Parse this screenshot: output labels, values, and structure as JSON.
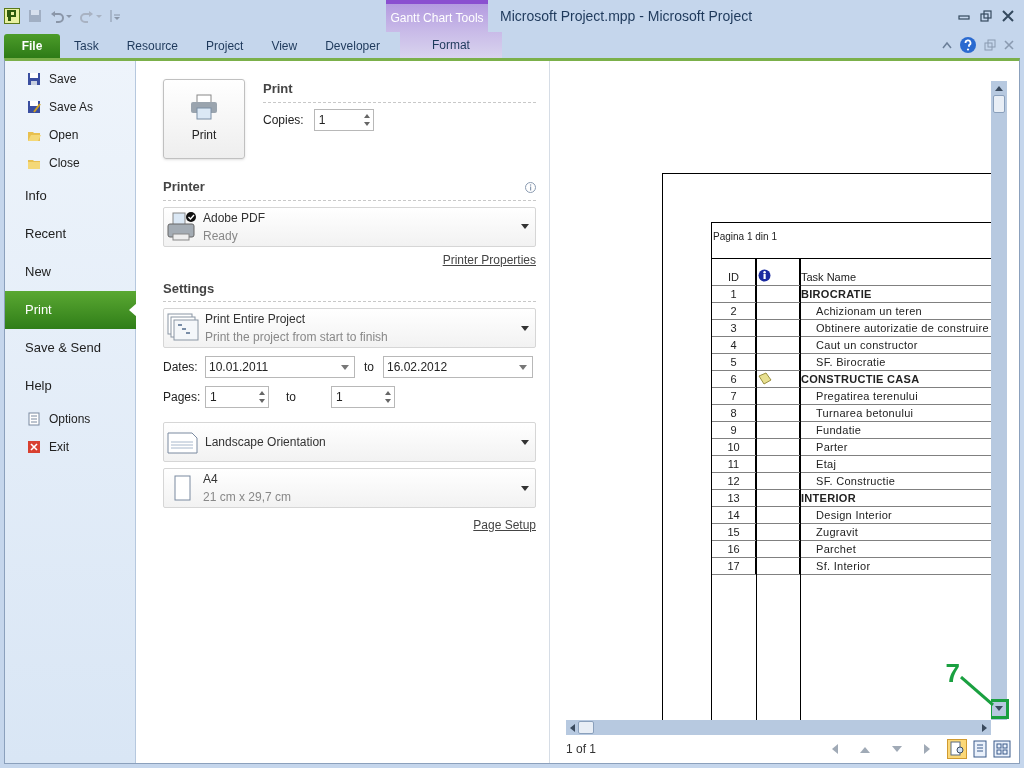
{
  "window": {
    "title": "Microsoft Project.mpp  -  Microsoft Project",
    "contextual_group": "Gantt Chart Tools"
  },
  "ribbon_tabs": [
    {
      "label": "File",
      "selected": true,
      "kind": "file"
    },
    {
      "label": "Task",
      "selected": false,
      "kind": "tab"
    },
    {
      "label": "Resource",
      "selected": false,
      "kind": "tab"
    },
    {
      "label": "Project",
      "selected": false,
      "kind": "tab"
    },
    {
      "label": "View",
      "selected": false,
      "kind": "tab"
    },
    {
      "label": "Developer",
      "selected": false,
      "kind": "tab"
    },
    {
      "label": "Format",
      "selected": false,
      "kind": "contextual"
    }
  ],
  "sidebar": {
    "items": [
      {
        "label": "Save",
        "kind": "command",
        "selected": false
      },
      {
        "label": "Save As",
        "kind": "command",
        "selected": false
      },
      {
        "label": "Open",
        "kind": "command",
        "selected": false
      },
      {
        "label": "Close",
        "kind": "command",
        "selected": false
      },
      {
        "label": "Info",
        "kind": "section",
        "selected": false
      },
      {
        "label": "Recent",
        "kind": "section",
        "selected": false
      },
      {
        "label": "New",
        "kind": "section",
        "selected": false
      },
      {
        "label": "Print",
        "kind": "section",
        "selected": true
      },
      {
        "label": "Save & Send",
        "kind": "section",
        "selected": false
      },
      {
        "label": "Help",
        "kind": "section",
        "selected": false
      },
      {
        "label": "Options",
        "kind": "command",
        "selected": false
      },
      {
        "label": "Exit",
        "kind": "command",
        "selected": false
      }
    ]
  },
  "print": {
    "heading": "Print",
    "button": "Print",
    "copies_label": "Copies:",
    "copies": "1"
  },
  "printer": {
    "heading": "Printer",
    "name": "Adobe PDF",
    "status": "Ready",
    "properties_link": "Printer Properties"
  },
  "settings": {
    "heading": "Settings",
    "scope": {
      "title": "Print Entire Project",
      "subtitle": "Print the project from start to finish"
    },
    "dates": {
      "label": "Dates:",
      "from": "10.01.2011",
      "to_label": "to",
      "to": "16.02.2012"
    },
    "pages": {
      "label": "Pages:",
      "from": "1",
      "to_label": "to",
      "to": "1"
    },
    "orientation": {
      "title": "Landscape Orientation"
    },
    "paper": {
      "title": "A4",
      "subtitle": "21 cm x 29,7 cm"
    },
    "page_setup_link": "Page Setup"
  },
  "preview": {
    "header": "Pagina 1 din 1",
    "columns": {
      "id": "ID",
      "name": "Task Name"
    },
    "rows": [
      {
        "id": "1",
        "name": "BIROCRATIE",
        "kind": "summary",
        "note": false
      },
      {
        "id": "2",
        "name": "Achizionam un teren",
        "kind": "task",
        "note": false
      },
      {
        "id": "3",
        "name": "Obtinere autorizatie de construire",
        "kind": "task",
        "note": false
      },
      {
        "id": "4",
        "name": "Caut un constructor",
        "kind": "task",
        "note": false
      },
      {
        "id": "5",
        "name": "SF. Birocratie",
        "kind": "task",
        "note": false
      },
      {
        "id": "6",
        "name": "CONSTRUCTIE CASA",
        "kind": "summary",
        "note": true
      },
      {
        "id": "7",
        "name": "Pregatirea terenului",
        "kind": "task",
        "note": false
      },
      {
        "id": "8",
        "name": "Turnarea betonului",
        "kind": "task",
        "note": false
      },
      {
        "id": "9",
        "name": "Fundatie",
        "kind": "task",
        "note": false
      },
      {
        "id": "10",
        "name": "Parter",
        "kind": "task",
        "note": false
      },
      {
        "id": "11",
        "name": "Etaj",
        "kind": "task",
        "note": false
      },
      {
        "id": "12",
        "name": "SF. Constructie",
        "kind": "task",
        "note": false
      },
      {
        "id": "13",
        "name": "INTERIOR",
        "kind": "summary",
        "note": false
      },
      {
        "id": "14",
        "name": "Design Interior",
        "kind": "task",
        "note": false
      },
      {
        "id": "15",
        "name": "Zugravit",
        "kind": "task",
        "note": false
      },
      {
        "id": "16",
        "name": "Parchet",
        "kind": "task",
        "note": false
      },
      {
        "id": "17",
        "name": "Sf. Interior",
        "kind": "task",
        "note": false
      }
    ],
    "page_count": "1 of 1"
  },
  "callout": {
    "label": "7"
  }
}
